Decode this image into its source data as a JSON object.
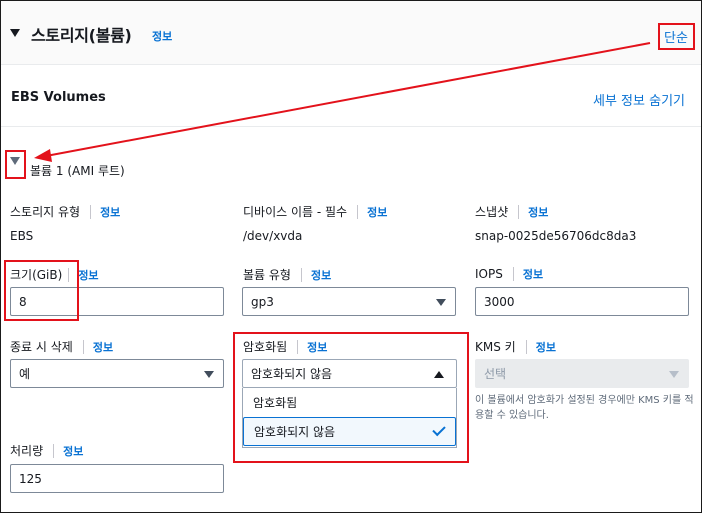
{
  "section": {
    "title": "스토리지(볼륨)",
    "info": "정보",
    "simple_link": "단순"
  },
  "ebs": {
    "title": "EBS Volumes",
    "hide_details": "세부 정보 숨기기"
  },
  "volume": {
    "label": "볼륨 1 (AMI 루트)"
  },
  "fields": {
    "storage_type": {
      "label": "스토리지 유형",
      "info": "정보",
      "value": "EBS"
    },
    "device_name": {
      "label": "디바이스 이름 - 필수",
      "info": "정보",
      "value": "/dev/xvda"
    },
    "snapshot": {
      "label": "스냅샷",
      "info": "정보",
      "value": "snap-0025de56706dc8da3"
    },
    "size": {
      "label": "크기(GiB)",
      "info": "정보",
      "value": "8"
    },
    "volume_type": {
      "label": "볼륨 유형",
      "info": "정보",
      "value": "gp3"
    },
    "iops": {
      "label": "IOPS",
      "info": "정보",
      "value": "3000"
    },
    "delete_on_termination": {
      "label": "종료 시 삭제",
      "info": "정보",
      "value": "예"
    },
    "encrypted": {
      "label": "암호화됨",
      "info": "정보",
      "value": "암호화되지 않음",
      "options": [
        "암호화됨",
        "암호화되지 않음"
      ]
    },
    "kms_key": {
      "label": "KMS 키",
      "info": "정보",
      "placeholder": "선택",
      "help": "이 볼륨에서 암호화가 설정된 경우에만 KMS 키를 적용할 수 있습니다."
    },
    "throughput": {
      "label": "처리량",
      "info": "정보",
      "value": "125"
    }
  },
  "colors": {
    "link": "#0972d3",
    "annotation": "#e3121b"
  }
}
